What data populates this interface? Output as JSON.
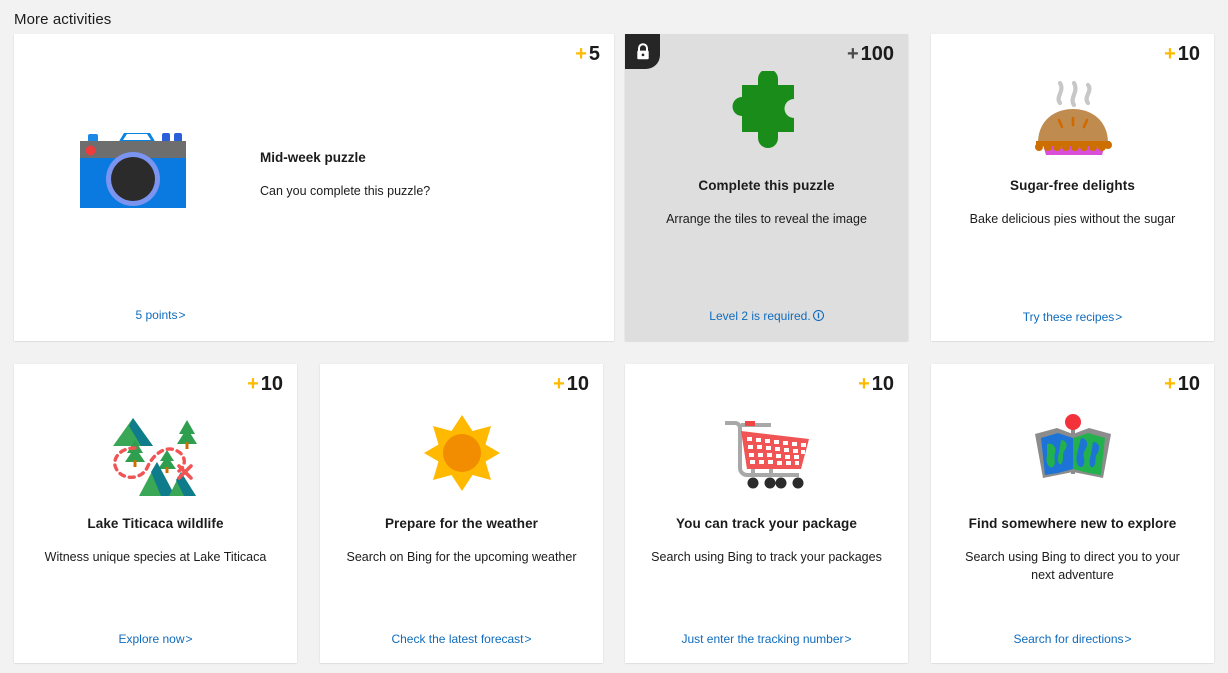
{
  "section": {
    "title": "More activities"
  },
  "colors": {
    "page_bg": "#f2f2f2",
    "card_bg": "#ffffff",
    "locked_card_bg": "#dedede",
    "points_plus": "#ffb900",
    "link": "#0f6cbd",
    "text": "#1b1b1b",
    "lock_badge_bg": "#262626"
  },
  "cards": [
    {
      "id": "midweek",
      "points_prefix": "+",
      "points": "5",
      "title": "Mid-week puzzle",
      "description": "Can you complete this puzzle?",
      "link": "5 points",
      "link_chevron": ">",
      "icon": "camera-icon",
      "locked": false
    },
    {
      "id": "puzzle",
      "points_prefix": "+",
      "points": "100",
      "title": "Complete this puzzle",
      "description": "Arrange the tiles to reveal the image",
      "link": "Level 2 is required.",
      "link_chevron": "",
      "icon": "puzzle-piece-icon",
      "locked": true,
      "lock_icon": "lock-icon",
      "info_icon": "info-icon"
    },
    {
      "id": "pie",
      "points_prefix": "+",
      "points": "10",
      "title": "Sugar-free delights",
      "description": "Bake delicious pies without the sugar",
      "link": "Try these recipes",
      "link_chevron": ">",
      "icon": "pie-icon",
      "locked": false
    },
    {
      "id": "lake",
      "points_prefix": "+",
      "points": "10",
      "title": "Lake Titicaca wildlife",
      "description": "Witness unique species at Lake Titicaca",
      "link": "Explore now",
      "link_chevron": ">",
      "icon": "trail-map-icon",
      "locked": false
    },
    {
      "id": "weather",
      "points_prefix": "+",
      "points": "10",
      "title": "Prepare for the weather",
      "description": "Search on Bing for the upcoming weather",
      "link": "Check the latest forecast",
      "link_chevron": ">",
      "icon": "sun-icon",
      "locked": false
    },
    {
      "id": "cart",
      "points_prefix": "+",
      "points": "10",
      "title": "You can track your package",
      "description": "Search using Bing to track your packages",
      "link": "Just enter the tracking number",
      "link_chevron": ">",
      "icon": "shopping-cart-icon",
      "locked": false
    },
    {
      "id": "map",
      "points_prefix": "+",
      "points": "10",
      "title": "Find somewhere new to explore",
      "description": "Search using Bing to direct you to your next adventure",
      "link": "Search for directions",
      "link_chevron": ">",
      "icon": "folded-map-icon",
      "locked": false
    }
  ]
}
